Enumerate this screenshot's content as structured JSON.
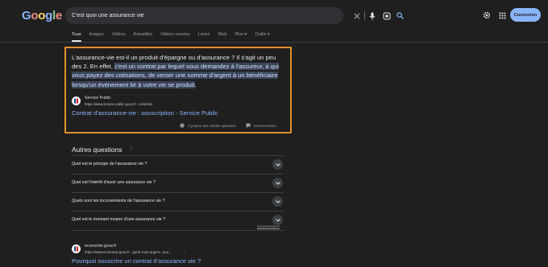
{
  "header": {
    "logo": "Google",
    "search_value": "C'est quoi une assurance vie",
    "signin_label": "Connexion"
  },
  "tabs": [
    "Tous",
    "Images",
    "Vidéos",
    "Actualités",
    "Vidéos courtes",
    "Livres",
    "Web",
    "Plus",
    "Outils"
  ],
  "snippet": {
    "text_plain": "L'assurance-vie est-il un produit d'épargne ou d'assurance ? Il s'agit un peu des 2. En effet, ",
    "text_highlight": "c'est un contrat par lequel vous demandez à l'assureur, à qui vous payez des cotisations, de verser une somme d'argent à un bénéficiaire lorsqu'un événement lié à votre vie se produit",
    "text_end": ".",
    "source_name": "Service Public",
    "source_url": "https://www.service-public.gouv.fr › vosdroits",
    "link": "Contrat d'assurance-vie : souscription - Service Public",
    "footer_about": "À propos des extraits optimisés",
    "footer_comments": "Commentaires"
  },
  "paa": {
    "title": "Autres questions",
    "questions": [
      "Quel est le principe de l'assurance vie ?",
      "Quel est l'intérêt d'avoir une assurance vie ?",
      "Quels sont les inconvénients de l'assurance vie ?",
      "Quel est le montant moyen d'une assurance vie ?"
    ],
    "comments": "Commentaires"
  },
  "result2": {
    "source_name": "economie.gouv.fr",
    "source_url": "https://www.economie.gouv.fr › gerer-mon-argent › pou...",
    "link": "Pourquoi souscrire un contrat d'assurance vie ?"
  }
}
